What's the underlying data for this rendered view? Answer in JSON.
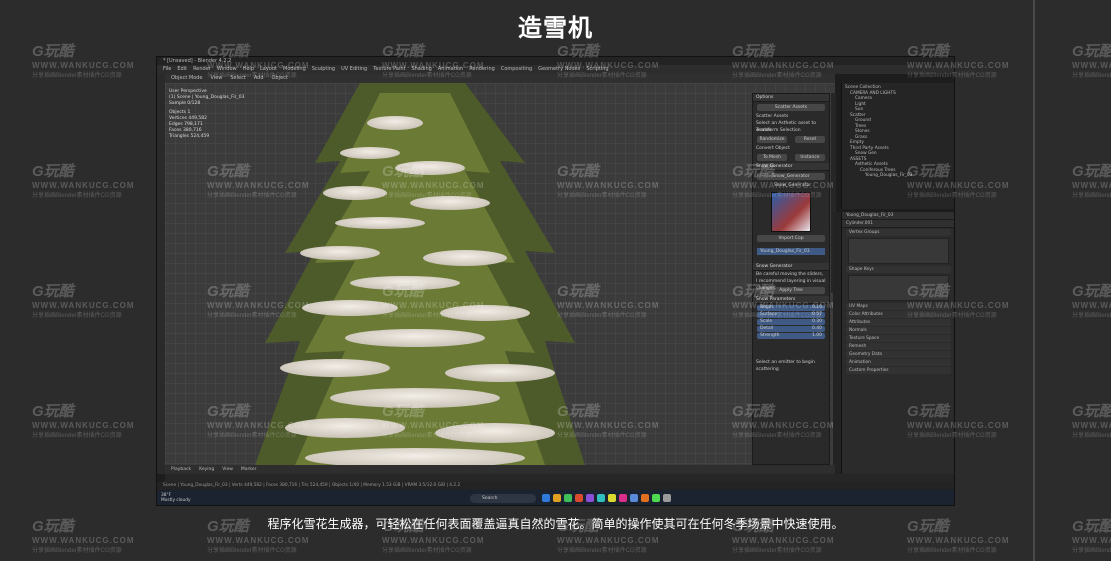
{
  "title": "造雪机",
  "caption": "程序化雪花生成器，可轻松在任何表面覆盖逼真自然的雪花。简单的操作使其可在任何冬季场景中快速使用。",
  "watermark": {
    "brand": "G玩酷",
    "url": "WWW.WANKUCG.COM",
    "sub": "分享插画Blender素材插件CG资源"
  },
  "blender": {
    "window_title": "* [Unsaved] - Blender 4.2.2",
    "menu": [
      "File",
      "Edit",
      "Render",
      "Window",
      "Help",
      "Layout",
      "Modeling",
      "Sculpting",
      "UV Editing",
      "Texture Paint",
      "Shading",
      "Animation",
      "Rendering",
      "Compositing",
      "Geometry Nodes",
      "Scripting"
    ],
    "header": [
      "Object Mode",
      "View",
      "Select",
      "Add",
      "Object"
    ],
    "viewport_stats": {
      "title": "User Perspective",
      "collection": "(1) Scene | Young_Douglas_Fir_03",
      "samples": "Sample 0/128",
      "objects_label": "Objects",
      "objects": "1",
      "vertices_label": "Vertices",
      "vertices": "449,582",
      "edges_label": "Edges",
      "edges": "798,171",
      "faces_label": "Faces",
      "faces": "380,716",
      "triangles_label": "Triangles",
      "triangles": "524,459"
    },
    "panel": {
      "tab": "Options",
      "scatter_btn": "Scatter Assets",
      "scatter_assets": "Scatter Assets",
      "select_hint": "Select an Asthetic asset to enable",
      "transform": "Transform Selection",
      "randomize": "Randomize",
      "reset": "Reset",
      "convert": "Convert Object",
      "to_mesh": "To Mesh",
      "instance": "Instance",
      "snow_gen": "Snow Generator",
      "snow_name": "Snow_Generator",
      "import": "Import Cop",
      "snow_asset": "Snow_Generator",
      "tree_label": "Young_Douglas_Fir_03",
      "snow_gen2": "Snow Generator",
      "note1": "Be careful moving the sliders,",
      "note2": "I recommend layering in visual changes.",
      "apply": "Apply Tree",
      "params": "Snow Parameters",
      "sliders": [
        {
          "name": "Begin",
          "val": "0.10"
        },
        {
          "name": "Surface",
          "val": "0.57"
        },
        {
          "name": "Scale",
          "val": "0.30"
        },
        {
          "name": "Detail",
          "val": "0.40"
        },
        {
          "name": "Strength",
          "val": "1.00"
        }
      ],
      "bottom": "Select an emitter to begin scattering"
    },
    "outliner": [
      "Scene Collection",
      "CAMERA AND LIGHTS",
      "Camera",
      "Light",
      "Sun",
      "Scatter",
      "Ground",
      "Trees",
      "Stones",
      "Grass",
      "Empty",
      "Third Party Assets",
      "Snow Gen",
      "ASSETS",
      "Asthetic Assets",
      "Coniferous Trees",
      "Young_Douglas_Fir_03"
    ],
    "properties": {
      "object": "Young_Douglas_Fir_03",
      "data": "Cylinder.001",
      "sections": [
        "Vertex Groups",
        "Shape Keys",
        "UV Maps",
        "Color Attributes",
        "Attributes",
        "Normals",
        "Texture Space",
        "Remesh",
        "Geometry Data",
        "Animation",
        "Custom Properties"
      ]
    },
    "timeline": [
      "Playback",
      "Keying",
      "View",
      "Marker"
    ],
    "status": "Scene | Young_Douglas_Fir_03 | Verts 449,582 | Faces 380,716 | Tris 524,459 | Objects 1/40 | Memory 1.53 GiB | VRAM 3.5/12.0 GiB | 4.2.2"
  },
  "taskbar": {
    "weather_temp": "38°F",
    "weather_text": "Mostly cloudy",
    "search": "Search",
    "icon_colors": [
      "#2f7ad9",
      "#e0a020",
      "#3fbf5a",
      "#d94a2f",
      "#8a4fd9",
      "#2fbfbf",
      "#d9d92f",
      "#d92f8a",
      "#5a8ad9",
      "#e07020",
      "#4fd94f",
      "#9a9a9a"
    ]
  }
}
